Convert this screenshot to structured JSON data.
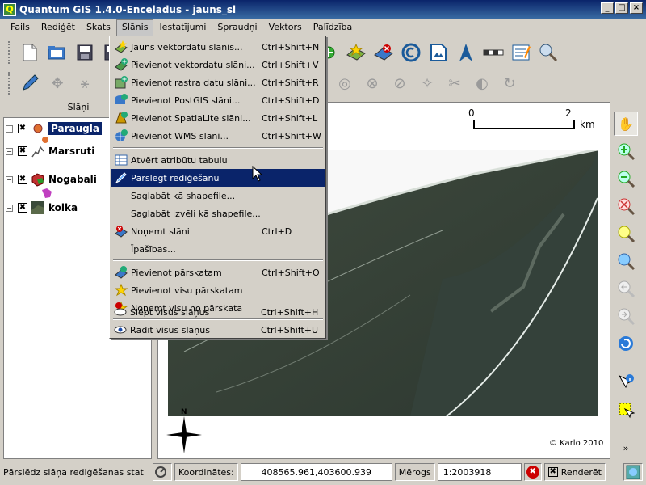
{
  "window": {
    "title": "Quantum GIS 1.4.0-Enceladus - jauns_sl",
    "app_icon": "Q",
    "minimize": "_",
    "maximize": "□",
    "close": "×"
  },
  "menubar": [
    "Fails",
    "Rediģēt",
    "Skats",
    "Slānis",
    "Iestatījumi",
    "Spraudņi",
    "Vektors",
    "Palīdzība"
  ],
  "menubar_open_index": 3,
  "layers_panel": {
    "title": "Slāņi",
    "close_glyph": "×",
    "layers": [
      {
        "name": "Paraugla",
        "checked": "✖",
        "selected": true,
        "icon": "point-layer-icon"
      },
      {
        "name": "Marsruti",
        "checked": "✖",
        "selected": false,
        "icon": "line-layer-icon"
      },
      {
        "name": "Nogabali",
        "checked": "✖",
        "selected": false,
        "icon": "polygon-layer-icon"
      },
      {
        "name": "kolka",
        "checked": "✖",
        "selected": false,
        "icon": "raster-layer-icon"
      }
    ]
  },
  "dropdown": {
    "items": [
      {
        "label": "Jauns vektordatu slānis...",
        "shortcut": "Ctrl+Shift+N",
        "icon": "new-vector-icon"
      },
      {
        "label": "Pievienot vektordatu slāni...",
        "shortcut": "Ctrl+Shift+V",
        "icon": "add-vector-icon"
      },
      {
        "label": "Pievienot rastra datu slāni...",
        "shortcut": "Ctrl+Shift+R",
        "icon": "add-raster-icon"
      },
      {
        "label": "Pievienot PostGIS slāni...",
        "shortcut": "Ctrl+Shift+D",
        "icon": "add-postgis-icon"
      },
      {
        "label": "Pievienot SpatiaLite slāni...",
        "shortcut": "Ctrl+Shift+L",
        "icon": "add-spatialite-icon"
      },
      {
        "label": "Pievienot WMS slāni...",
        "shortcut": "Ctrl+Shift+W",
        "icon": "add-wms-icon"
      },
      {
        "label": "Atvērt atribūtu tabulu",
        "shortcut": "",
        "icon": "attribute-table-icon"
      },
      {
        "label": "Pārslēgt rediģēšanu",
        "shortcut": "",
        "icon": "toggle-editing-icon",
        "highlighted": true
      },
      {
        "label": "Saglabāt kā shapefile...",
        "shortcut": "",
        "icon": ""
      },
      {
        "label": "Saglabāt izvēli kā shapefile...",
        "shortcut": "",
        "icon": ""
      },
      {
        "label": "Noņemt slāni",
        "shortcut": "Ctrl+D",
        "icon": "remove-layer-icon"
      },
      {
        "label": "Īpašības...",
        "shortcut": "",
        "icon": ""
      },
      {
        "label": "Pievienot pārskatam",
        "shortcut": "Ctrl+Shift+O",
        "icon": "add-overview-icon"
      },
      {
        "label": "Pievienot visu pārskatam",
        "shortcut": "",
        "icon": "add-all-overview-icon"
      },
      {
        "label": "Noņemt visu no pārskata",
        "shortcut": "",
        "icon": "remove-all-overview-icon"
      },
      {
        "label": "Slēpt visus slāņus",
        "shortcut": "Ctrl+Shift+H",
        "icon": "hide-all-icon"
      },
      {
        "label": "Rādīt visus slāņus",
        "shortcut": "Ctrl+Shift+U",
        "icon": "show-all-icon"
      }
    ]
  },
  "map": {
    "scale_start": "0",
    "scale_end": "2",
    "scale_unit": "km",
    "north_label": "N",
    "copyright": "© Karlo 2010"
  },
  "statusbar": {
    "message": "Pārslēdz slāņa rediģēšanas stat",
    "coords_label": "Koordinātes:",
    "coords_value": "408565.961,403600.939",
    "scale_label": "Mērogs",
    "scale_value": "1:2003918",
    "render_label": "Renderēt",
    "render_check": "✖",
    "stop_glyph": "✖"
  },
  "colors": {
    "titlebar": "#0a246a",
    "menu_highlight": "#0a246a",
    "chrome": "#d4d0c8",
    "render_stop": "#cc0000"
  }
}
